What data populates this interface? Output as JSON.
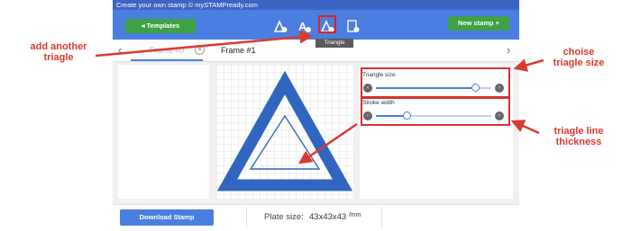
{
  "app": {
    "window_title": "Create your own stamp © mySTAMPready.com",
    "templates_label": "◂  Templates",
    "new_stamp_label": "New stamp +",
    "tooltip": "Triangle",
    "tabs": [
      {
        "label": "Frame #0",
        "close": "✕"
      },
      {
        "label": "Frame #1"
      }
    ],
    "nav_prev": "‹",
    "nav_next": "›",
    "controls": {
      "triangle_size": {
        "label": "Triangle size",
        "value": 0.86,
        "dec": "‹",
        "inc": "›"
      },
      "stroke_width": {
        "label": "Stroke width",
        "value": 0.27,
        "dec": "‹",
        "inc": "›"
      }
    },
    "download_label": "Download Stamp",
    "plate_label": "Plate size:",
    "plate_value": "43x43x43",
    "plate_unit": "/mm"
  },
  "toolbar_icons": [
    "add-text-triangle-icon",
    "add-text-icon",
    "add-triangle-icon",
    "add-image-icon"
  ],
  "annotations": {
    "add_triangle": "add another\ntriagle",
    "size": "choise\ntriagle size",
    "thickness": "triagle line\nthickness"
  },
  "colors": {
    "toolbar": "#4a7ee0",
    "green_button": "#3fa146",
    "annotation_red": "#d93b30",
    "stamp_blue": "#3166c0"
  }
}
